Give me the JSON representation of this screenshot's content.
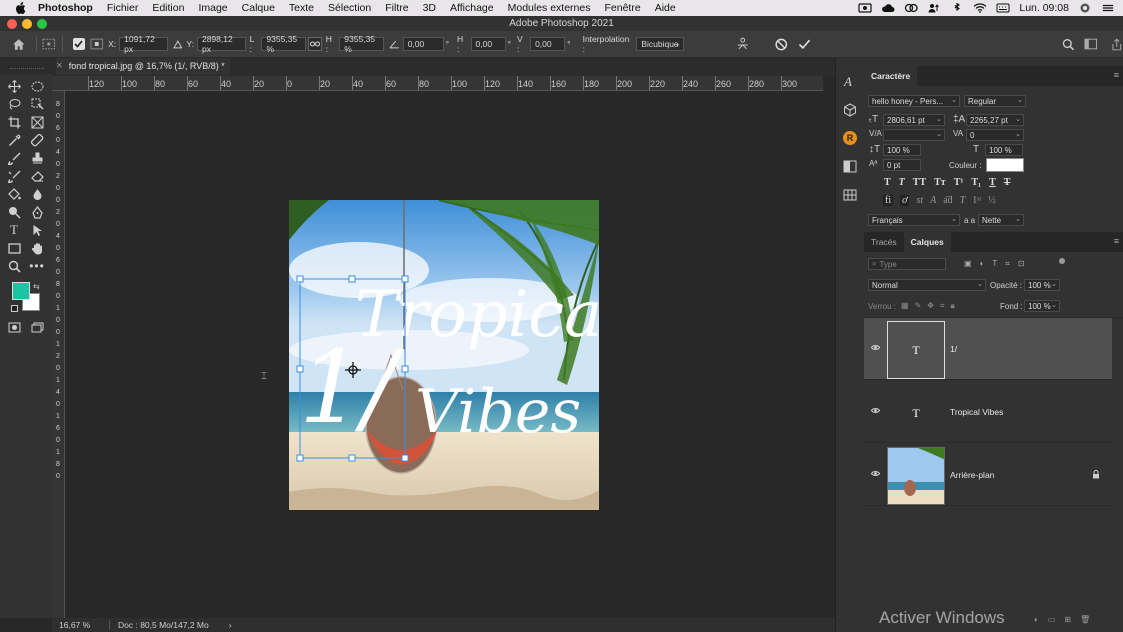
{
  "menubar": {
    "app": "Photoshop",
    "items": [
      "Fichier",
      "Edition",
      "Image",
      "Calque",
      "Texte",
      "Sélection",
      "Filtre",
      "3D",
      "Affichage",
      "Modules externes",
      "Fenêtre",
      "Aide"
    ],
    "clock": "Lun. 09:08"
  },
  "window": {
    "title": "Adobe Photoshop 2021"
  },
  "options": {
    "x_label": "X:",
    "x_value": "1091,72 px",
    "y_label": "Y:",
    "y_value": "2898,12 px",
    "w_label": "L :",
    "w_value": "9355,35 %",
    "h_label": "H :",
    "h_value": "9355,35 %",
    "angle_value": "0,00",
    "angle_unit": "°",
    "hskew_label": "H :",
    "hskew_value": "0,00",
    "vskew_label": "V :",
    "vskew_value": "0,00",
    "interp_label": "Interpolation :",
    "interp_value": "Bicubique"
  },
  "document": {
    "tab_title": "fond tropical.jpg @ 16,7% (1/, RVB/8) *"
  },
  "rulers": {
    "top": [
      "120",
      "100",
      "80",
      "60",
      "40",
      "20",
      "0",
      "20",
      "40",
      "60",
      "80",
      "100",
      "120",
      "140",
      "160",
      "180",
      "200",
      "220",
      "240",
      "260",
      "280",
      "300"
    ],
    "left": [
      "8",
      "0",
      "6",
      "0",
      "4",
      "0",
      "2",
      "0",
      "0",
      "2",
      "0",
      "4",
      "0",
      "6",
      "0",
      "8",
      "0",
      "1",
      "0",
      "0",
      "1",
      "2",
      "0",
      "1",
      "4",
      "0",
      "1",
      "6",
      "0",
      "1",
      "8",
      "0"
    ]
  },
  "artwork": {
    "line1": "Tropical",
    "line2": "Vibes",
    "overlay": "1/"
  },
  "status": {
    "zoom": "16,67 %",
    "doc": "Doc : 80,5 Mo/147,2 Mo",
    "arrow": "›"
  },
  "character": {
    "tab": "Caractère",
    "font": "hello honey - Pers...",
    "style": "Regular",
    "size": "2806,61 pt",
    "leading": "2265,27 pt",
    "kerning": "",
    "tracking": "0",
    "vscale": "100 %",
    "hscale": "100 %",
    "baseline": "0 pt",
    "color_label": "Couleur :",
    "language": "Français",
    "aa_label": "a a",
    "antialias": "Nette"
  },
  "layers_panel": {
    "tabs": [
      "Tracés",
      "Calques"
    ],
    "filter": "Type",
    "blend": "Normal",
    "opacity_label": "Opacité :",
    "opacity": "100 %",
    "lock_label": "Verrou :",
    "fill_label": "Fond :",
    "fill": "100 %",
    "layers": [
      {
        "name": "1/",
        "type": "text",
        "selected": true
      },
      {
        "name": "Tropical Vibes",
        "type": "text",
        "selected": false
      },
      {
        "name": "Arrière-plan",
        "type": "image",
        "selected": false,
        "locked": true
      }
    ]
  },
  "watermark": "Activer Windows",
  "colors": {
    "foreground": "#1dc4a4",
    "background": "#ffffff",
    "accent": "#3a8ee6"
  }
}
